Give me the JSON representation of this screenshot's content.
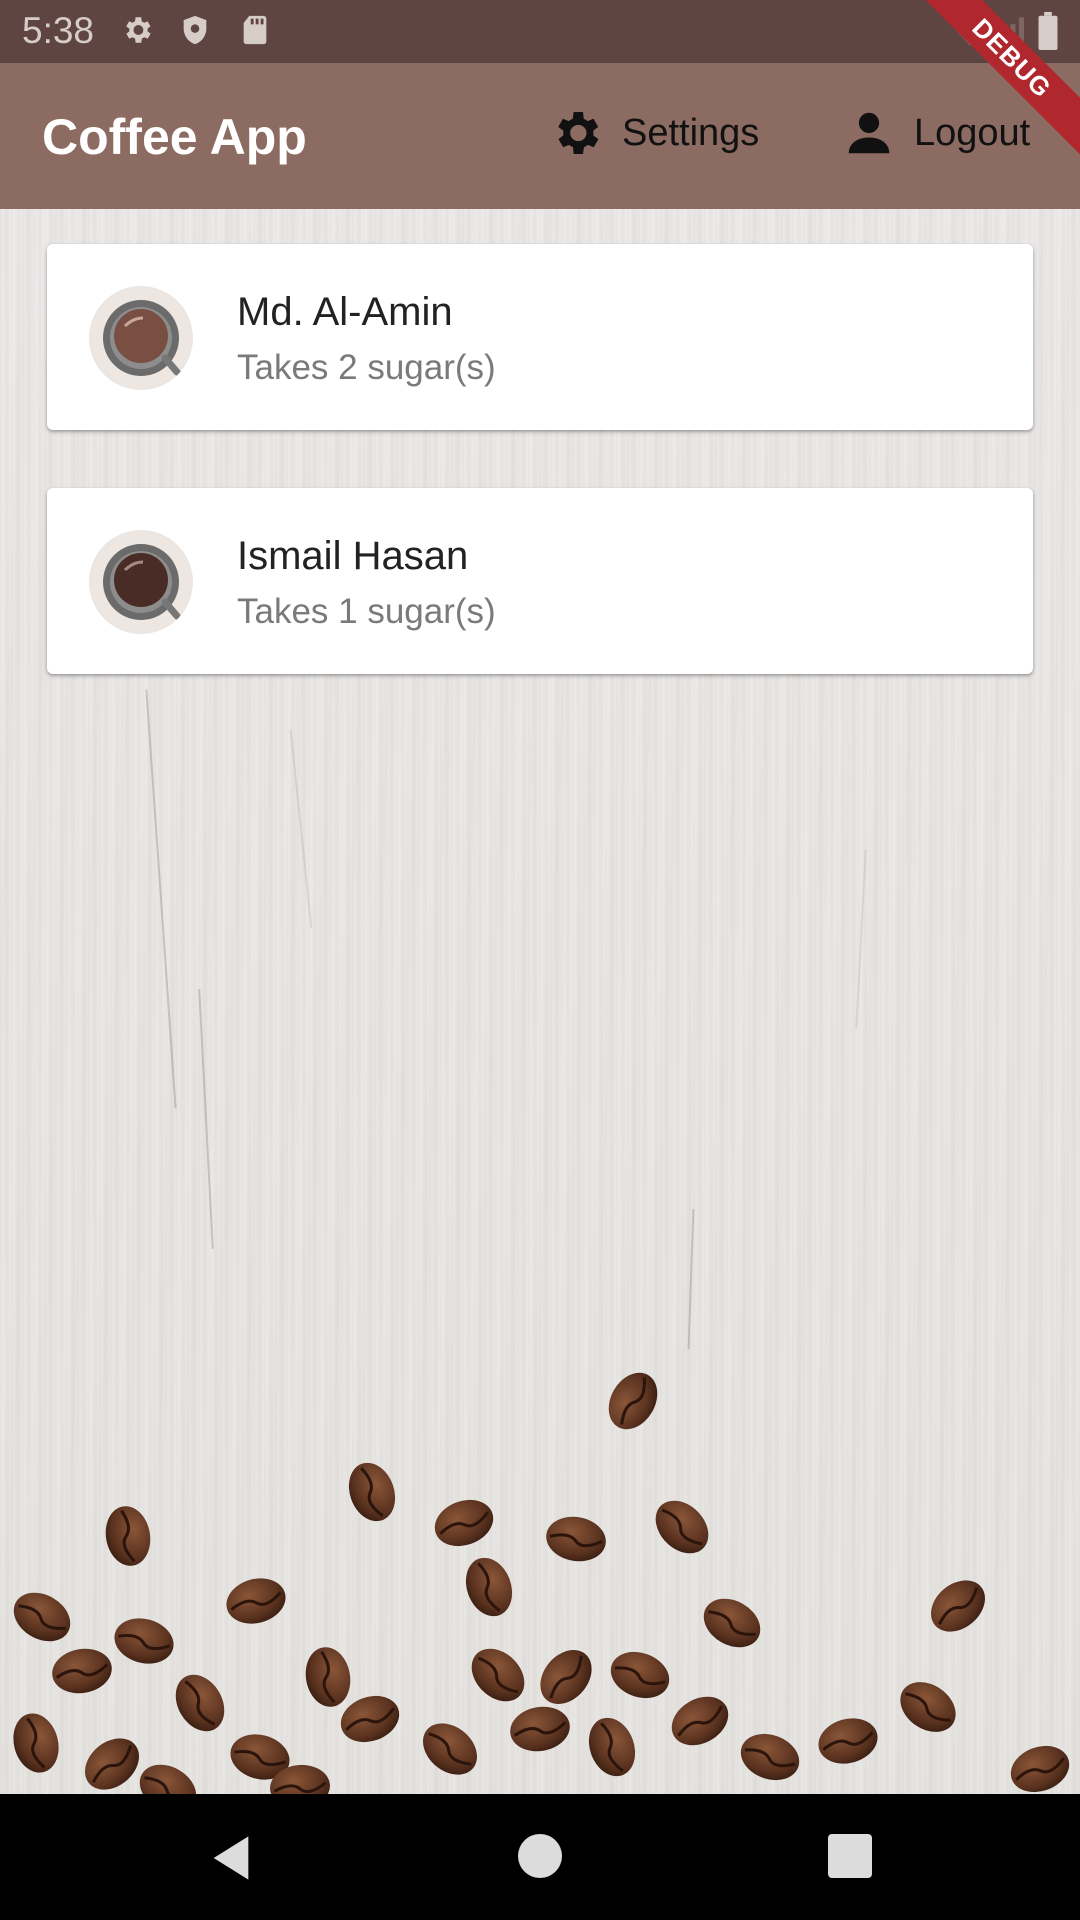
{
  "status_bar": {
    "time": "5:38",
    "icons": [
      "gear-icon",
      "shield-icon",
      "sd-card-icon",
      "wifi-icon",
      "signal-icon",
      "battery-icon"
    ]
  },
  "app_bar": {
    "title": "Coffee App",
    "settings_label": "Settings",
    "logout_label": "Logout"
  },
  "debug_banner": "DEBUG",
  "brews": [
    {
      "name": "Md. Al-Amin",
      "subtitle": "Takes 2 sugar(s)",
      "coffee_color": "#7a4f43"
    },
    {
      "name": "Ismail Hasan",
      "subtitle": "Takes 1 sugar(s)",
      "coffee_color": "#4a2c27"
    }
  ],
  "colors": {
    "app_bar": "#8c6b62",
    "status_bar": "#5e4541",
    "debug_ribbon": "#b0272d"
  },
  "nav_bar": {
    "icons": [
      "back-icon",
      "home-icon",
      "recents-icon"
    ]
  }
}
